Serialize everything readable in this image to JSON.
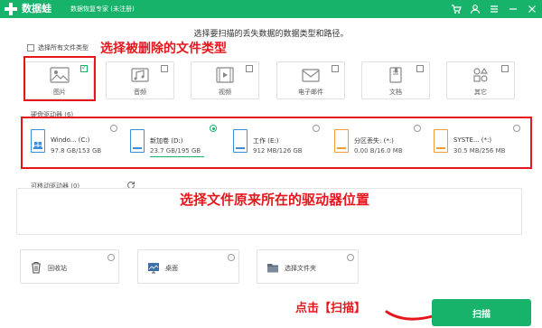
{
  "window": {
    "app_name": "数据蛙",
    "subtitle": "数据恢复专家 (未注册)",
    "controls": [
      "cart-icon",
      "user-icon",
      "menu-icon",
      "minimize-icon",
      "close-icon"
    ]
  },
  "page_title": "选择要扫描的丢失数据的数据类型和路径。",
  "select_all": {
    "label": "选择所有文件类型",
    "checked": false
  },
  "file_types": [
    {
      "label": "图片",
      "icon": "image-icon",
      "checked": true
    },
    {
      "label": "音频",
      "icon": "audio-icon",
      "checked": false
    },
    {
      "label": "视频",
      "icon": "video-icon",
      "checked": false
    },
    {
      "label": "电子邮件",
      "icon": "email-icon",
      "checked": false
    },
    {
      "label": "文档",
      "icon": "document-icon",
      "checked": false
    },
    {
      "label": "其它",
      "icon": "other-icon",
      "checked": false
    }
  ],
  "hard_drives": {
    "label": "硬盘驱动器 (6)",
    "items": [
      {
        "name": "Windo... (C:)",
        "size": "97.8 GB/153 GB",
        "selected": false,
        "color": "blue"
      },
      {
        "name": "新加卷 (D:)",
        "size": "23.7 GB/195 GB",
        "selected": true,
        "color": "blue"
      },
      {
        "name": "工作 (E:)",
        "size": "912 MB/126 GB",
        "selected": false,
        "color": "blue"
      },
      {
        "name": "分区丢失: (*:)",
        "size": "0.00 B/16.0 MB",
        "selected": false,
        "color": "orange"
      },
      {
        "name": "SYSTE... (*:)",
        "size": "30.5 MB/256 MB",
        "selected": false,
        "color": "orange"
      }
    ]
  },
  "removable": {
    "label": "可移动驱动器 (0)",
    "refresh_icon": "refresh-icon"
  },
  "locations": [
    {
      "label": "回收站",
      "icon": "recycle-bin-icon"
    },
    {
      "label": "桌面",
      "icon": "desktop-icon"
    },
    {
      "label": "选择文件夹",
      "icon": "folder-icon"
    }
  ],
  "annotations": {
    "types": "选择被删除的文件类型",
    "drives": "选择文件原来所在的驱动器位置",
    "scan": "点击【扫描】"
  },
  "scan_button": "扫描",
  "colors": {
    "brand": "#17b36b",
    "annotation": "#e6161c",
    "drive_blue": "#3a8dd8",
    "drive_orange": "#f19d32"
  }
}
